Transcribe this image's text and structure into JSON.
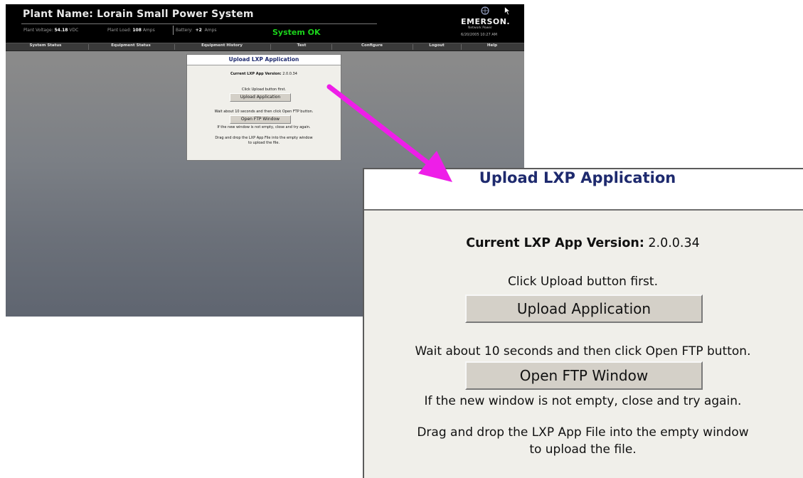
{
  "header": {
    "plant_name": "Plant Name: Lorain Small Power System",
    "stats": {
      "voltage_label": "Plant Voltage:",
      "voltage_value": "54.18",
      "voltage_unit": "VDC",
      "load_label": "Plant Load:",
      "load_value": "108",
      "load_unit": "Amps",
      "battery_label": "Battery:",
      "battery_value": "+2",
      "battery_unit": "Amps"
    },
    "system_status": "System OK",
    "logo_text": "EMERSON.",
    "logo_subtext": "Network Power",
    "datetime": "6/20/2005 10:27 AM"
  },
  "nav": {
    "items": [
      {
        "label": "System Status"
      },
      {
        "label": "Equipment Status"
      },
      {
        "label": "Equipment History"
      },
      {
        "label": "Test"
      },
      {
        "label": "Configure"
      },
      {
        "label": "Logout"
      },
      {
        "label": "Help"
      }
    ]
  },
  "panel": {
    "title": "Upload LXP Application",
    "version_label": "Current LXP App Version:",
    "version_value": "2.0.0.34",
    "step1_text": "Click Upload button first.",
    "upload_button": "Upload Application",
    "step2_text": "Wait about 10 seconds and then click Open FTP button.",
    "ftp_button": "Open FTP Window",
    "step3_text": "If the new window is not empty, close and try again.",
    "step4_line1": "Drag and drop the LXP App File into the empty window",
    "step4_line2": "to upload the file."
  },
  "colors": {
    "header_bg": "#000000",
    "status_ok": "#1bd41b",
    "title_blue": "#1e2a6e",
    "arrow": "#ee1ee8",
    "button_face": "#d4d0c8"
  },
  "icons": [
    "emerson-logo-icon",
    "mouse-cursor-icon",
    "callout-arrow-icon"
  ]
}
